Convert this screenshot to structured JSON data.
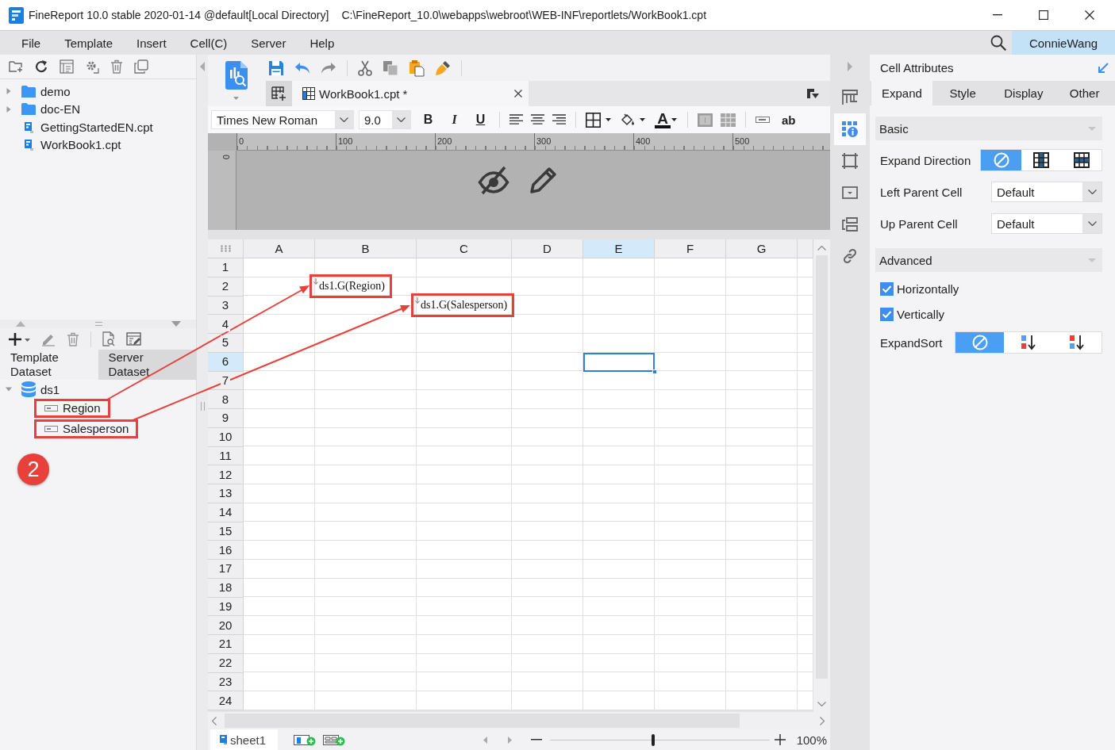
{
  "window": {
    "title": "FineReport 10.0 stable 2020-01-14 @default[Local Directory]",
    "path": "C:\\FineReport_10.0\\webapps\\webroot\\WEB-INF\\reportlets/WorkBook1.cpt"
  },
  "menu": [
    "File",
    "Template",
    "Insert",
    "Cell(C)",
    "Server",
    "Help"
  ],
  "user": "ConnieWang",
  "file_tree": [
    {
      "kind": "folder",
      "label": "demo",
      "expanded": false
    },
    {
      "kind": "folder",
      "label": "doc-EN",
      "expanded": false
    },
    {
      "kind": "report",
      "label": "GettingStartedEN.cpt"
    },
    {
      "kind": "report",
      "label": "WorkBook1.cpt"
    }
  ],
  "dataset_tabs": [
    {
      "label": "Template Dataset",
      "selected": true
    },
    {
      "label": "Server Dataset",
      "selected": false
    }
  ],
  "datasets": [
    {
      "label": "ds1",
      "expanded": true,
      "children": [
        {
          "label": "Region",
          "annotated": true
        },
        {
          "label": "Salesperson",
          "annotated": true
        }
      ]
    }
  ],
  "annotation": {
    "badge": "2"
  },
  "editor": {
    "tabs": [
      {
        "label": "WorkBook1.cpt *",
        "selected": true
      }
    ],
    "font": "Times New Roman",
    "font_size": "9.0",
    "style_buttons": [
      {
        "kind": "bold",
        "label": "B"
      },
      {
        "kind": "italic",
        "label": "I"
      },
      {
        "kind": "underline",
        "label": "U"
      }
    ],
    "font_color_button": "A",
    "text_button": "ab",
    "ruler": {
      "ticks": [
        "0",
        "100",
        "200",
        "300",
        "400",
        "500"
      ],
      "side_ticks": [
        "0"
      ]
    }
  },
  "sheet": {
    "columns": [
      {
        "label": "A",
        "selected": false
      },
      {
        "label": "B",
        "selected": false
      },
      {
        "label": "C",
        "selected": false
      },
      {
        "label": "D",
        "selected": false
      },
      {
        "label": "E",
        "selected": true
      },
      {
        "label": "F",
        "selected": false
      },
      {
        "label": "G",
        "selected": false
      }
    ],
    "rows": [
      {
        "label": "1",
        "selected": false
      },
      {
        "label": "2",
        "selected": false,
        "cells": [
          {},
          {
            "text": "ds1.G(Region)",
            "annotated": true,
            "expanding": true
          }
        ]
      },
      {
        "label": "3",
        "selected": false,
        "cells": [
          {},
          {},
          {
            "text": "ds1.G(Salesperson)",
            "annotated": true,
            "expanding": true
          }
        ]
      },
      {
        "label": "4",
        "selected": false
      },
      {
        "label": "5",
        "selected": false
      },
      {
        "label": "6",
        "selected": true
      },
      {
        "label": "7",
        "selected": false
      },
      {
        "label": "8",
        "selected": false
      },
      {
        "label": "9",
        "selected": false
      },
      {
        "label": "10",
        "selected": false
      },
      {
        "label": "11",
        "selected": false
      },
      {
        "label": "12",
        "selected": false
      },
      {
        "label": "13",
        "selected": false
      },
      {
        "label": "14",
        "selected": false
      },
      {
        "label": "15",
        "selected": false
      },
      {
        "label": "16",
        "selected": false
      },
      {
        "label": "17",
        "selected": false
      },
      {
        "label": "18",
        "selected": false
      },
      {
        "label": "19",
        "selected": false
      },
      {
        "label": "20",
        "selected": false
      },
      {
        "label": "21",
        "selected": false
      },
      {
        "label": "22",
        "selected": false
      },
      {
        "label": "23",
        "selected": false
      },
      {
        "label": "24",
        "selected": false
      }
    ],
    "tabs": [
      {
        "label": "sheet1",
        "selected": true
      }
    ],
    "zoom": {
      "level": 0.47,
      "label": "100%"
    }
  },
  "side_tabs": [
    {
      "kind": "header",
      "selected": false
    },
    {
      "kind": "attributes",
      "selected": true
    },
    {
      "kind": "frame",
      "selected": false
    },
    {
      "kind": "widget",
      "selected": false
    },
    {
      "kind": "stack",
      "selected": false
    },
    {
      "kind": "link",
      "selected": false
    }
  ],
  "properties": {
    "title": "Cell Attributes",
    "tabs": [
      {
        "label": "Expand",
        "selected": true
      },
      {
        "label": "Style",
        "selected": false
      },
      {
        "label": "Display",
        "selected": false
      },
      {
        "label": "Other",
        "selected": false
      }
    ],
    "sections": [
      {
        "title": "Basic",
        "expanded": true,
        "rows": [
          {
            "kind": "segmented",
            "label": "Expand Direction",
            "options": [
              {
                "kind": "none",
                "selected": true
              },
              {
                "kind": "vertical",
                "selected": false
              },
              {
                "kind": "horizontal",
                "selected": false
              }
            ]
          },
          {
            "kind": "dropdown",
            "label": "Left Parent Cell",
            "value": "Default"
          },
          {
            "kind": "dropdown",
            "label": "Up Parent Cell",
            "value": "Default"
          }
        ]
      },
      {
        "title": "Advanced",
        "expanded": true,
        "rows": [
          {
            "kind": "checkbox",
            "label": "Horizontally",
            "checked": true
          },
          {
            "kind": "checkbox",
            "label": "Vertically",
            "checked": true
          },
          {
            "kind": "segmented",
            "label": "ExpandSort",
            "options": [
              {
                "kind": "none",
                "selected": true
              },
              {
                "kind": "ascending",
                "selected": false
              },
              {
                "kind": "descending",
                "selected": false
              }
            ]
          }
        ]
      }
    ]
  }
}
